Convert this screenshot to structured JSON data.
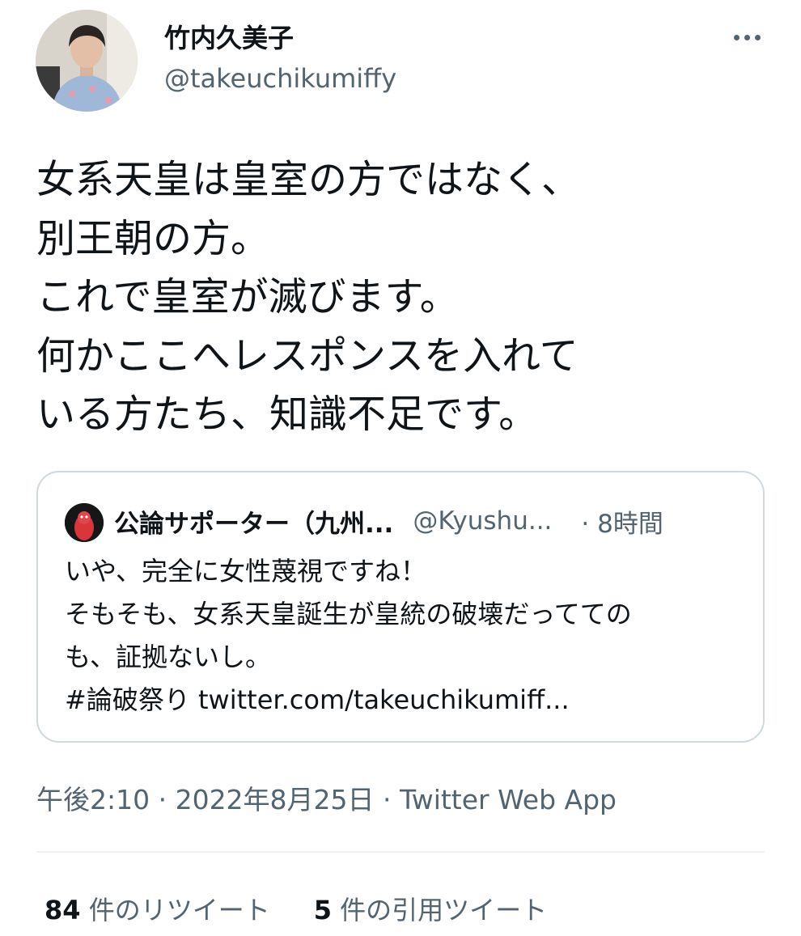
{
  "author": {
    "display_name": "竹内久美子",
    "handle": "@takeuchikumiffy"
  },
  "tweet": {
    "text": "女系天皇は皇室の方ではなく、\n別王朝の方。\nこれで皇室が滅びます。\n何かここへレスポンスを入れて\nいる方たち、知識不足です。"
  },
  "quote": {
    "name": "公論サポーター（九州...",
    "handle": "@Kyushu...",
    "time": "· 8時間",
    "text": "いや、完全に女性蔑視ですね！\nそもそも、女系天皇誕生が皇統の破壊だってての\nも、証拠ないし。\n#論破祭り twitter.com/takeuchikumiff..."
  },
  "meta": {
    "timestamp": "午後2:10 · 2022年8月25日 · Twitter Web App"
  },
  "stats": {
    "retweets_count": "84",
    "retweets_label": " 件のリツイート",
    "quotes_count": "5",
    "quotes_label": " 件の引用ツイート"
  },
  "colors": {
    "text_primary": "#0f1419",
    "text_secondary": "#536471",
    "border": "#cfd9de",
    "divider": "#eff3f4"
  },
  "icons": {
    "more": "more-horizontal-icon"
  }
}
